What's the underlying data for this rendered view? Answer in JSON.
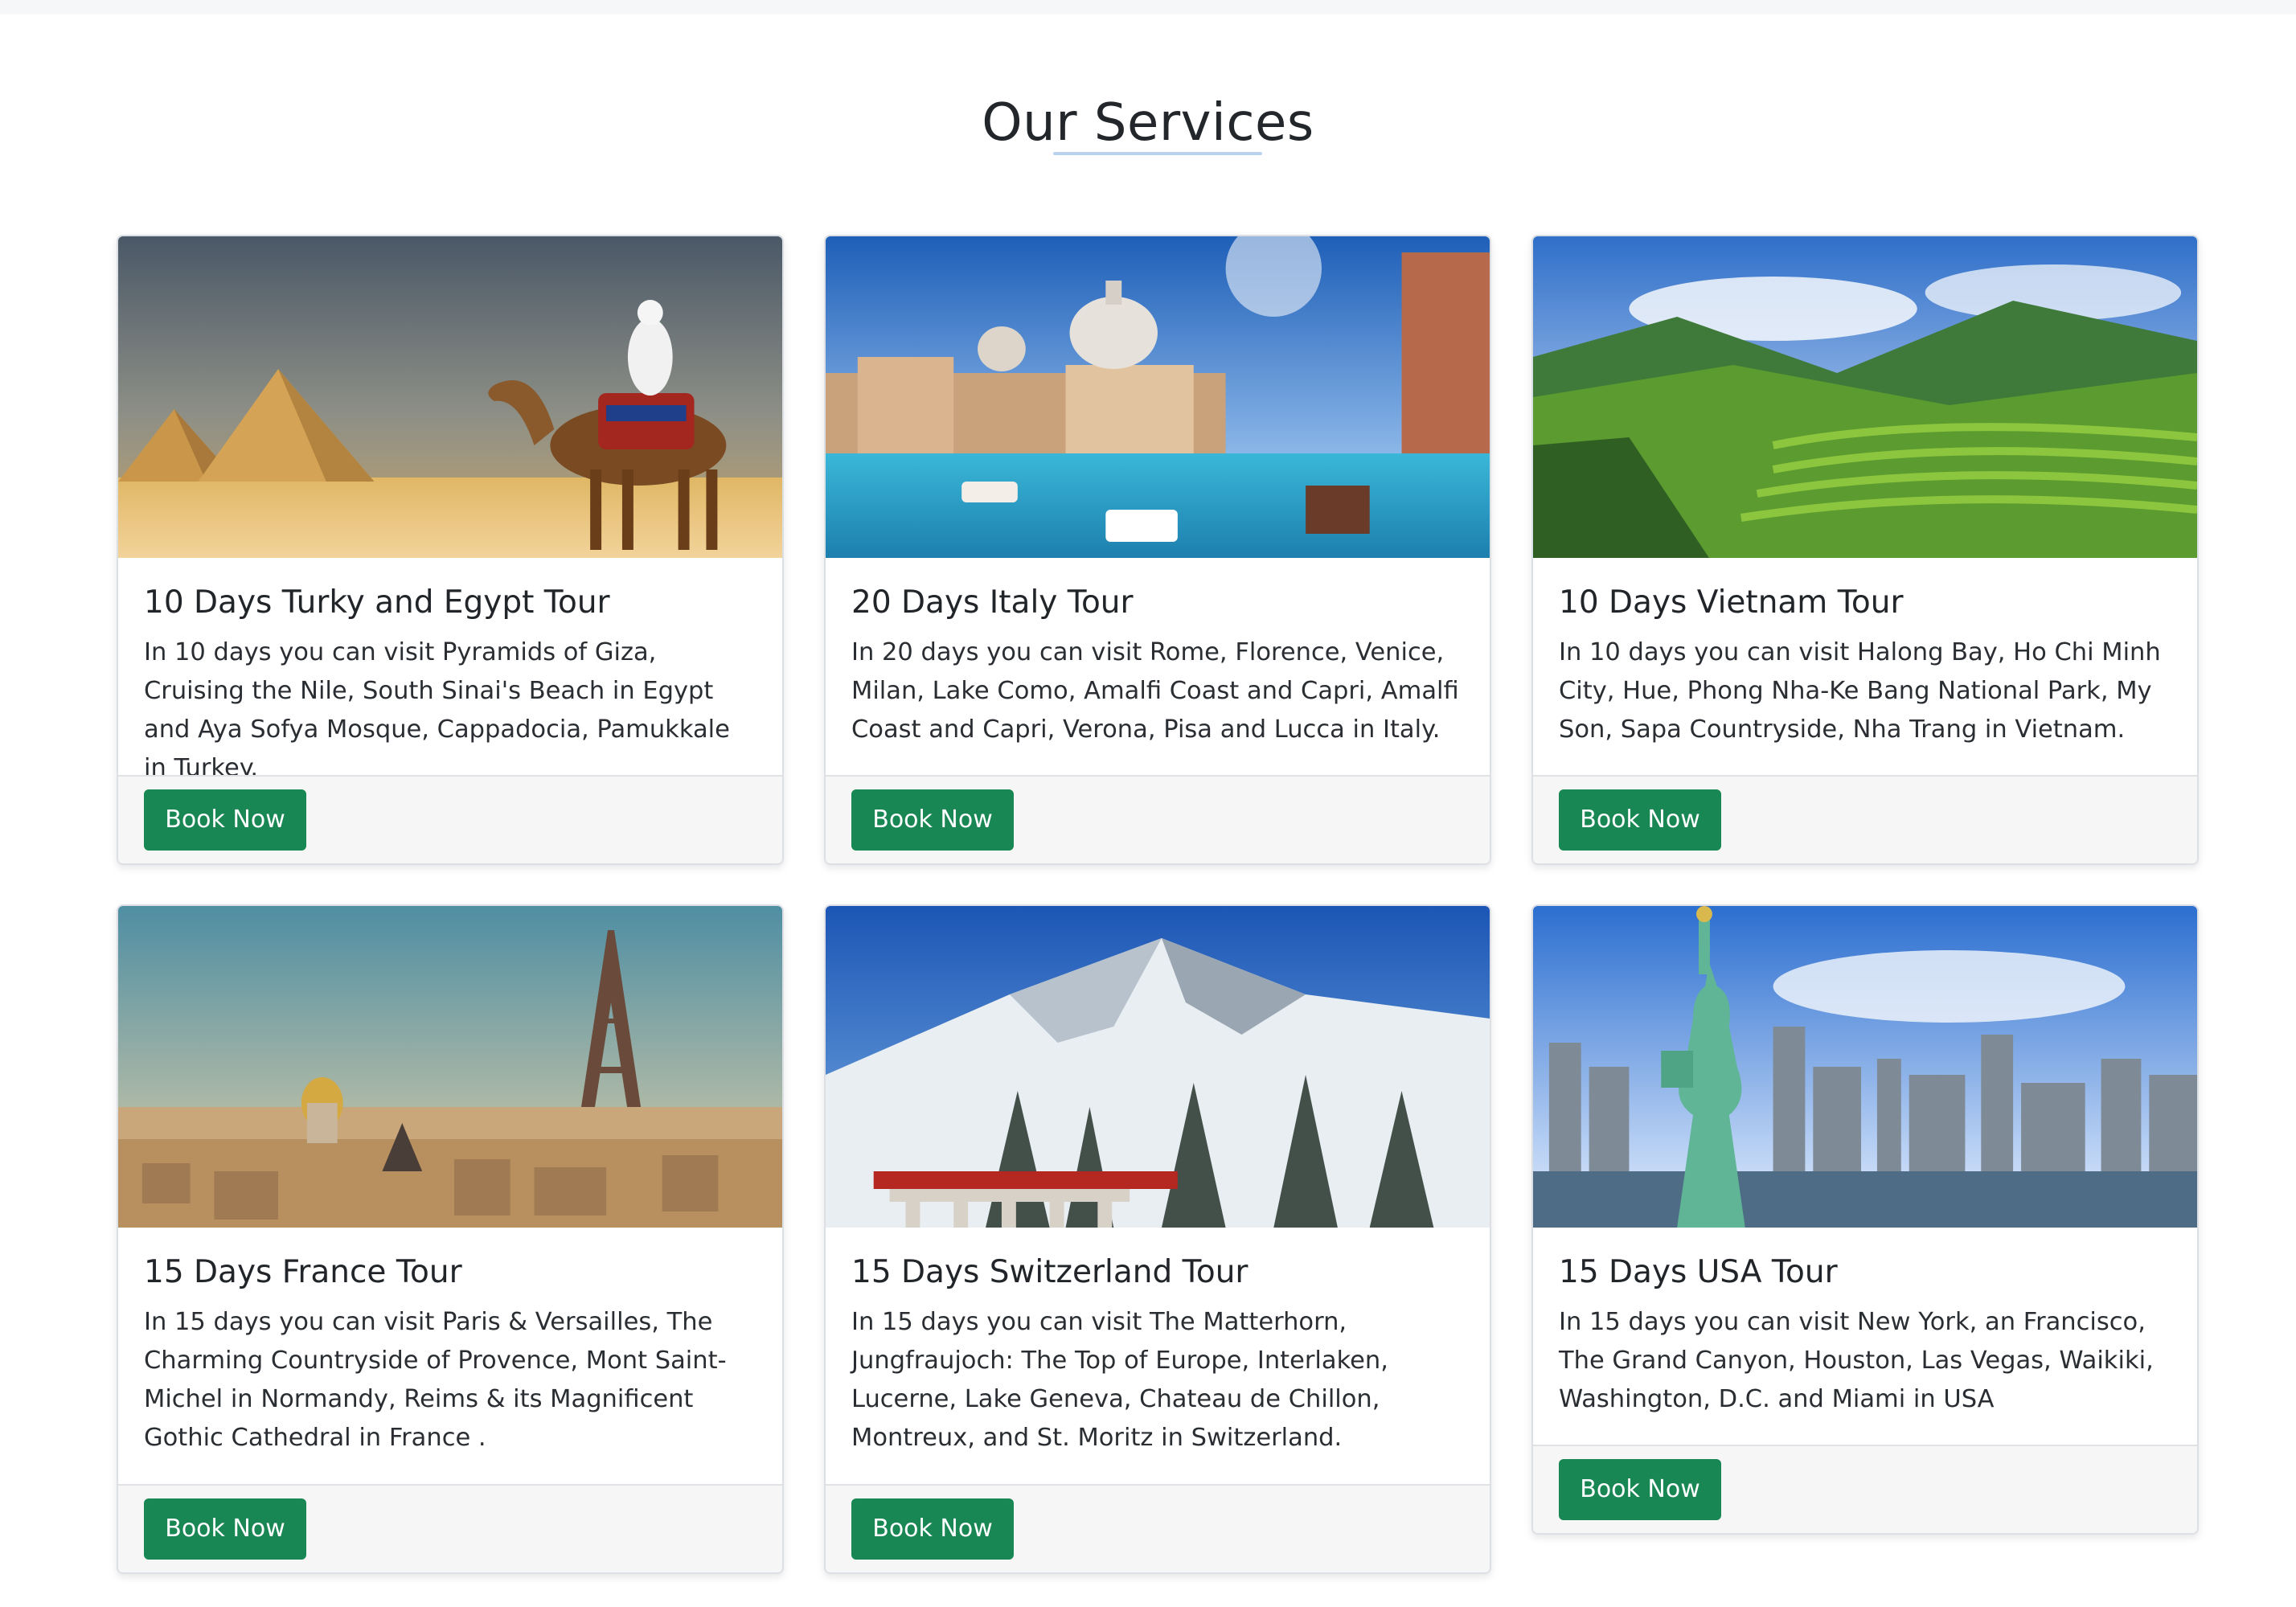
{
  "section": {
    "title": "Our Services"
  },
  "cards": [
    {
      "title": "10 Days Turky and Egypt Tour",
      "text": "In 10 days you can visit Pyramids of Giza, Cruising the Nile, South Sinai's Beach in Egypt and Aya Sofya Mosque, Cappadocia, Pamukkale in Turkey.",
      "button": "Book Now",
      "image": "egypt-pyramids-camel"
    },
    {
      "title": "20 Days Italy Tour",
      "text": "In 20 days you can visit Rome, Florence, Venice, Milan, Lake Como, Amalfi Coast and Capri, Amalfi Coast and Capri, Verona, Pisa and Lucca in Italy.",
      "button": "Book Now",
      "image": "venice-grand-canal"
    },
    {
      "title": "10 Days Vietnam Tour",
      "text": "In 10 days you can visit Halong Bay, Ho Chi Minh City, Hue, Phong Nha-Ke Bang National Park, My Son, Sapa Countryside, Nha Trang in Vietnam.",
      "button": "Book Now",
      "image": "vietnam-rice-terraces"
    },
    {
      "title": "15 Days France Tour",
      "text": "In 15 days you can visit Paris & Versailles, The Charming Countryside of Provence, Mont Saint-Michel in Normandy, Reims & its Magnificent Gothic Cathedral in France .",
      "button": "Book Now",
      "image": "paris-eiffel-tower"
    },
    {
      "title": "15 Days Switzerland Tour",
      "text": "In 15 days you can visit The Matterhorn, Jungfraujoch: The Top of Europe, Interlaken, Lucerne, Lake Geneva, Chateau de Chillon, Montreux, and St. Moritz in Switzerland.",
      "button": "Book Now",
      "image": "swiss-alps-train-viaduct"
    },
    {
      "title": "15 Days USA Tour",
      "text": "In 15 days you can visit New York, an Francisco, The Grand Canyon, Houston, Las Vegas, Waikiki, Washington, D.C. and Miami in USA",
      "button": "Book Now",
      "image": "statue-of-liberty-nyc-skyline"
    }
  ],
  "colors": {
    "button": "#198754",
    "underline": "#b9d3ee",
    "footer": "#f6f6f6"
  }
}
